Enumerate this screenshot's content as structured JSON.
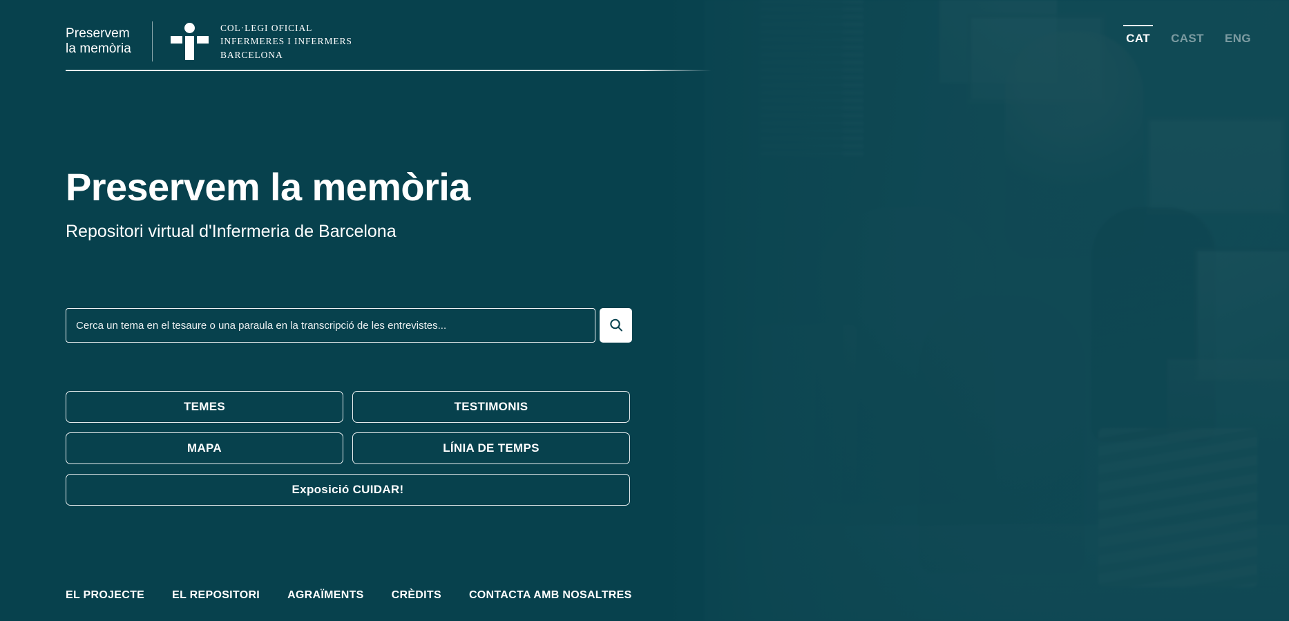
{
  "colors": {
    "background": "#05414e",
    "text": "#ffffff",
    "inactive_lang": "rgba(255,255,255,0.45)",
    "search_button_bg": "#ffffff"
  },
  "header": {
    "brand_name": "Preservem\nla memòria",
    "org_mark_icon": "nurse-cross-icon",
    "org_name": "COL·LEGI OFICIAL\nINFERMERES I INFERMERS\nBARCELONA",
    "languages": [
      {
        "code": "CAT",
        "active": true
      },
      {
        "code": "CAST",
        "active": false
      },
      {
        "code": "ENG",
        "active": false
      }
    ]
  },
  "hero": {
    "title": "Preservem la memòria",
    "subtitle": "Repositori virtual d'Infermeria de Barcelona"
  },
  "search": {
    "placeholder": "Cerca un tema en el tesaure o una paraula en la transcripció de les entrevistes...",
    "value": "",
    "button_icon": "search-icon"
  },
  "nav_buttons": [
    {
      "label": "TEMES"
    },
    {
      "label": "TESTIMONIS"
    },
    {
      "label": "MAPA"
    },
    {
      "label": "LÍNIA DE TEMPS"
    },
    {
      "label": "Exposició CUIDAR!"
    }
  ],
  "footer": {
    "links": [
      {
        "label": "EL PROJECTE"
      },
      {
        "label": "EL REPOSITORI"
      },
      {
        "label": "AGRAÏMENTS"
      },
      {
        "label": "CRÈDITS"
      },
      {
        "label": "CONTACTA AMB NOSALTRES"
      }
    ]
  }
}
